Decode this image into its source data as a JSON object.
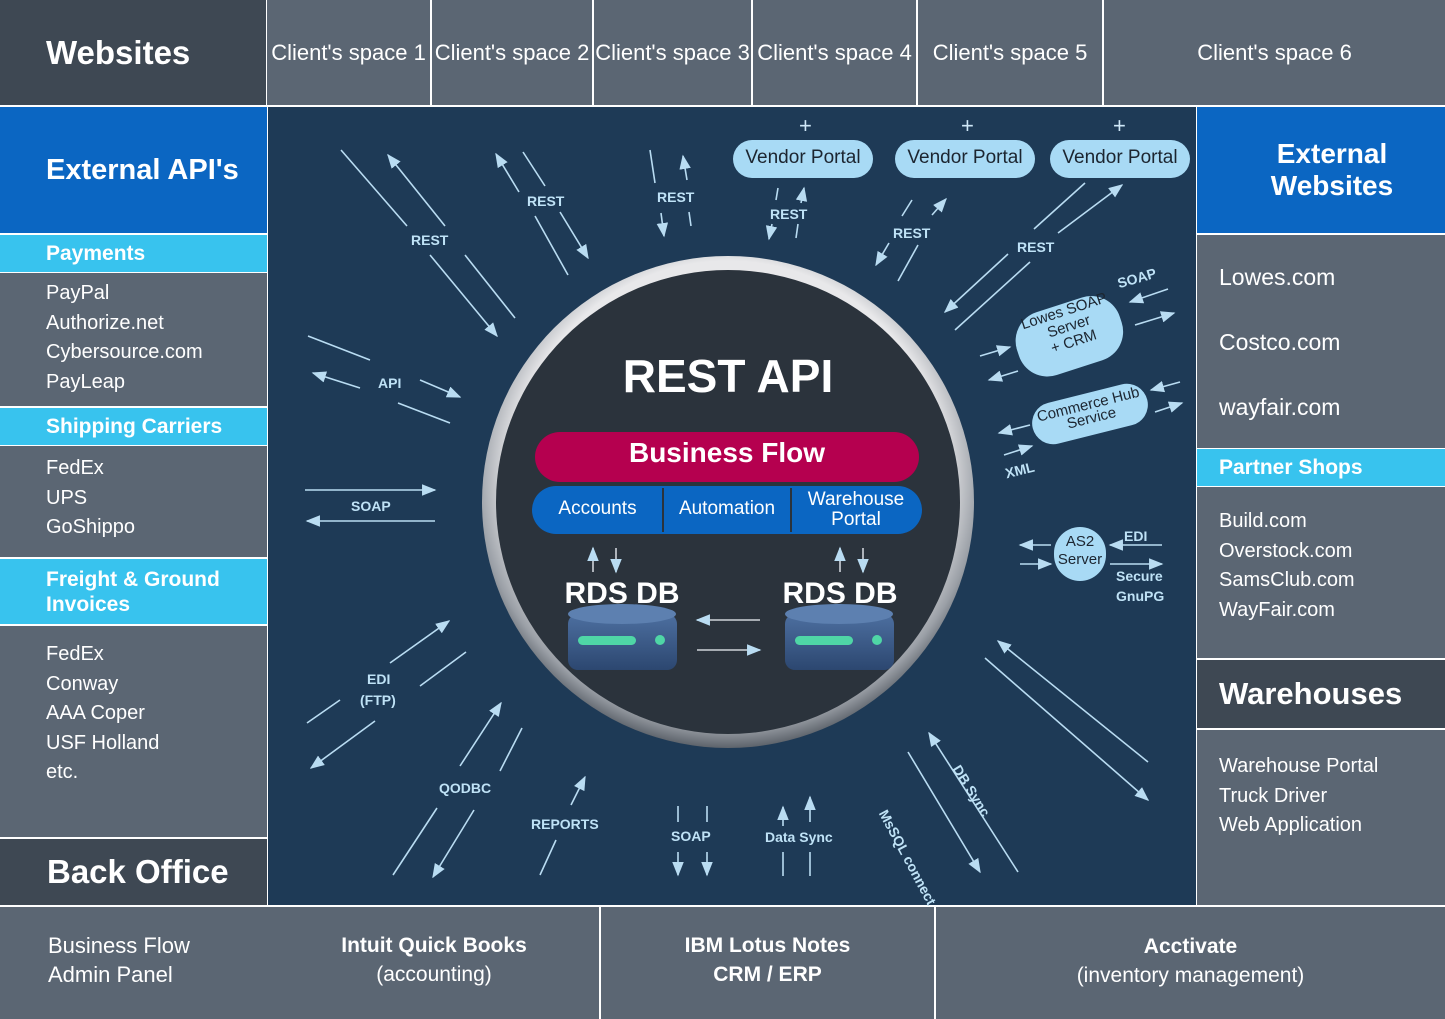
{
  "header": {
    "title": "Websites",
    "clients": [
      "Client's space 1",
      "Client's space 2",
      "Client's space 3",
      "Client's space 4",
      "Client's space 5",
      "Client's space 6"
    ]
  },
  "left": {
    "external_apis": "External API's",
    "payments": {
      "title": "Payments",
      "items": [
        "PayPal",
        "Authorize.net",
        "Cybersource.com",
        "PayLeap"
      ]
    },
    "shipping": {
      "title": "Shipping Carriers",
      "items": [
        "FedEx",
        "UPS",
        "GoShippo"
      ]
    },
    "freight": {
      "title_line1": "Freight & Ground",
      "title_line2": "Invoices",
      "items": [
        "FedEx",
        "Conway",
        "AAA Coper",
        "USF Holland",
        "etc."
      ]
    },
    "back_office": "Back Office"
  },
  "right": {
    "external_websites": "External Websites",
    "sites": [
      "Lowes.com",
      "Costco.com",
      "wayfair.com"
    ],
    "partner_shops": {
      "title": "Partner Shops",
      "items": [
        "Build.com",
        "Overstock.com",
        "SamsClub.com",
        "WayFair.com"
      ]
    },
    "warehouses": {
      "title": "Warehouses",
      "items": [
        "Warehouse Portal",
        "Truck Driver",
        "Web Application"
      ]
    }
  },
  "bottom": {
    "admin": [
      "Business Flow",
      "Admin Panel"
    ],
    "quickbooks": [
      "Intuit Quick Books",
      "(accounting)"
    ],
    "lotus": [
      "IBM Lotus Notes",
      "CRM / ERP"
    ],
    "acctivate": [
      "Acctivate",
      "(inventory management)"
    ]
  },
  "center": {
    "title": "REST API",
    "business_flow": "Business Flow",
    "modules": [
      "Accounts",
      "Automation",
      "Warehouse",
      "Portal"
    ],
    "db": "RDS DB"
  },
  "diagram": {
    "vendor_portal": "Vendor Portal",
    "plus": "+",
    "rest": "REST",
    "api": "API",
    "soap": "SOAP",
    "edi": "EDI",
    "ftp": "(FTP)",
    "qodbc": "QODBC",
    "reports": "REPORTS",
    "data_sync": "Data Sync",
    "msql": "MsSQL connect",
    "db_sync": "DB Sync",
    "xml": "XML",
    "secure": "Secure",
    "gnupg": "GnuPG",
    "lowes_soap": [
      "Lowes SOAP",
      "Server",
      "+ CRM"
    ],
    "commerce_hub": [
      "Commerce Hub",
      "Service"
    ],
    "as2": [
      "AS2",
      "Server"
    ]
  },
  "colors": {
    "gray": "#5b6673",
    "dark": "#3e4853",
    "blue": "#0b66c2",
    "cyan": "#38c3ee",
    "navy": "#1e3a56",
    "magenta": "#b5004f"
  }
}
